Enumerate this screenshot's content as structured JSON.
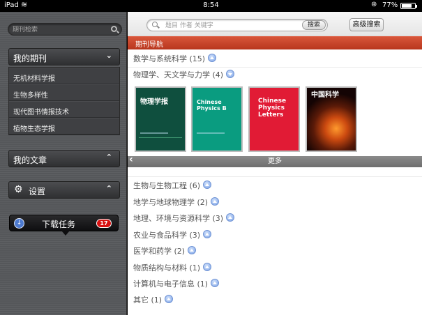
{
  "status_bar": {
    "carrier": "iPad",
    "time": "8:54",
    "battery_percent": "77%",
    "battery_level": 0.77
  },
  "sidebar": {
    "search_placeholder": "期刊检索",
    "my_journals": {
      "title": "我的期刊",
      "items": [
        {
          "label": "无机材料学报"
        },
        {
          "label": "生物多样性"
        },
        {
          "label": "现代图书情报技术"
        },
        {
          "label": "植物生态学报"
        }
      ]
    },
    "my_articles": {
      "title": "我的文章"
    },
    "settings": {
      "title": "设置"
    },
    "download": {
      "label": "下载任务",
      "badge": "17"
    }
  },
  "main": {
    "search": {
      "placeholder": "题目 作者 关键字",
      "button": "搜索"
    },
    "advanced_button": "高级搜索",
    "nav_title": "期刊导航",
    "categories_top": [
      {
        "label": "数学与系统科学 (15)",
        "expanded": false
      },
      {
        "label": "物理学、天文学与力学 (4)",
        "expanded": true
      }
    ],
    "covers": [
      {
        "title": "物理学报"
      },
      {
        "title": "Chinese Physics B"
      },
      {
        "title": "Chinese Physics Letters"
      },
      {
        "title": "中国科学"
      }
    ],
    "more_label": "更多",
    "categories_bottom": [
      {
        "label": "生物与生物工程 (6)"
      },
      {
        "label": "地学与地球物理学 (2)"
      },
      {
        "label": "地理、环境与资源科学 (3)"
      },
      {
        "label": "农业与食品科学 (3)"
      },
      {
        "label": "医学和药学 (2)"
      },
      {
        "label": "物质结构与材料 (1)"
      },
      {
        "label": "计算机与电子信息 (1)"
      },
      {
        "label": "其它 (1)"
      }
    ]
  },
  "colors": {
    "nav_bar": "#c8452a",
    "cover_1": "#0f4f3e",
    "cover_2": "#0a9c80",
    "cover_3": "#e11b35",
    "badge": "#d81212"
  }
}
